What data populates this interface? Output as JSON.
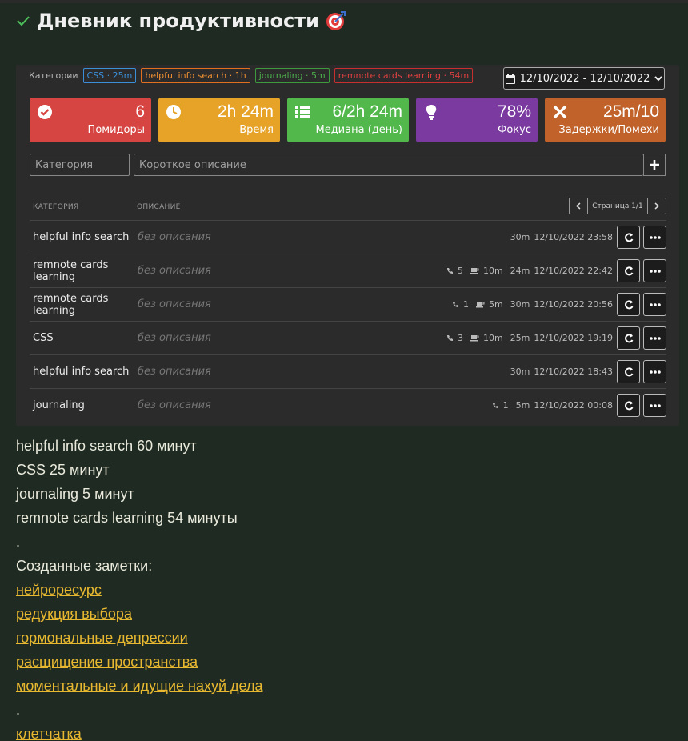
{
  "title": "Дневник продуктивности",
  "categories_label": "Категории",
  "categories": [
    {
      "text": "CSS · 25m",
      "class": "chip-css"
    },
    {
      "text": "helpful info search · 1h",
      "class": "chip-helpful"
    },
    {
      "text": "journaling · 5m",
      "class": "chip-journaling"
    },
    {
      "text": "remnote cards learning · 54m",
      "class": "chip-remnote"
    }
  ],
  "date_range": "12/10/2022 - 12/10/2022",
  "stats": {
    "pomodoros": {
      "value": "6",
      "label": "Помидоры"
    },
    "time": {
      "value": "2h 24m",
      "label": "Время"
    },
    "median": {
      "value": "6/2h 24m",
      "label": "Медиана (день)"
    },
    "focus": {
      "value": "78%",
      "label": "Фокус"
    },
    "delays": {
      "value": "25m/10",
      "label": "Задержки/Помехи"
    }
  },
  "inputs": {
    "category_placeholder": "Категория",
    "description_placeholder": "Короткое описание"
  },
  "table": {
    "col_category": "КАТЕГОРИЯ",
    "col_description": "ОПИСАНИЕ",
    "page": "Страница 1/1"
  },
  "rows": [
    {
      "category": "helpful info search",
      "description": "без описания",
      "calls": "",
      "coffee": "",
      "duration": "30m",
      "datetime": "12/10/2022 23:58"
    },
    {
      "category": "remnote cards learning",
      "description": "без описания",
      "calls": "5",
      "coffee": "10m",
      "duration": "24m",
      "datetime": "12/10/2022 22:42"
    },
    {
      "category": "remnote cards learning",
      "description": "без описания",
      "calls": "1",
      "coffee": "5m",
      "duration": "30m",
      "datetime": "12/10/2022 20:56"
    },
    {
      "category": "CSS",
      "description": "без описания",
      "calls": "3",
      "coffee": "10m",
      "duration": "25m",
      "datetime": "12/10/2022 19:19"
    },
    {
      "category": "helpful info search",
      "description": "без описания",
      "calls": "",
      "coffee": "",
      "duration": "30m",
      "datetime": "12/10/2022 18:43"
    },
    {
      "category": "journaling",
      "description": "без описания",
      "calls": "1",
      "coffee": "",
      "duration": "5m",
      "datetime": "12/10/2022 00:08"
    }
  ],
  "summary": [
    "helpful info search 60 минут",
    "CSS 25 минут",
    "journaling 5 минут",
    "remnote cards learning 54 минуты",
    "."
  ],
  "notes_heading": "Созданные заметки:",
  "notes_links": [
    "нейроресурс",
    "редукция выбора",
    "гормональные депрессии",
    "расщищение пространства",
    "моментальные и идущие нахуй дела"
  ],
  "notes_separator": ".",
  "notes_links_2": [
    "клетчатка"
  ],
  "colors": {
    "pomodoros": "#d64541",
    "time": "#e6a328",
    "median": "#52b84c",
    "focus": "#7a3aa0",
    "delays": "#c0622a",
    "link": "#e8b830"
  }
}
